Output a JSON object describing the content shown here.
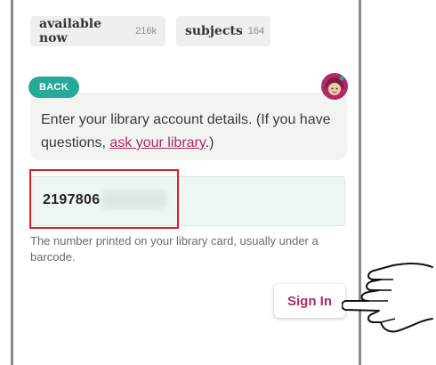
{
  "filters": [
    {
      "name": "available now",
      "count": "216k"
    },
    {
      "name": "subjects",
      "count": "164"
    }
  ],
  "back_label": "BACK",
  "instructions": {
    "prefix": "Enter your library account details. (If you have questions, ",
    "link": "ask your library",
    "suffix": ".)"
  },
  "card_number": {
    "visible_value": "2197806"
  },
  "card_hint": "The number printed on your library card, usually under a barcode.",
  "sign_in_label": "Sign In",
  "colors": {
    "accent_teal": "#27a99a",
    "link_magenta": "#b02a63",
    "highlight_red": "#e02020"
  },
  "icons": [
    "library-avatar-icon",
    "pointing-hand-icon"
  ]
}
